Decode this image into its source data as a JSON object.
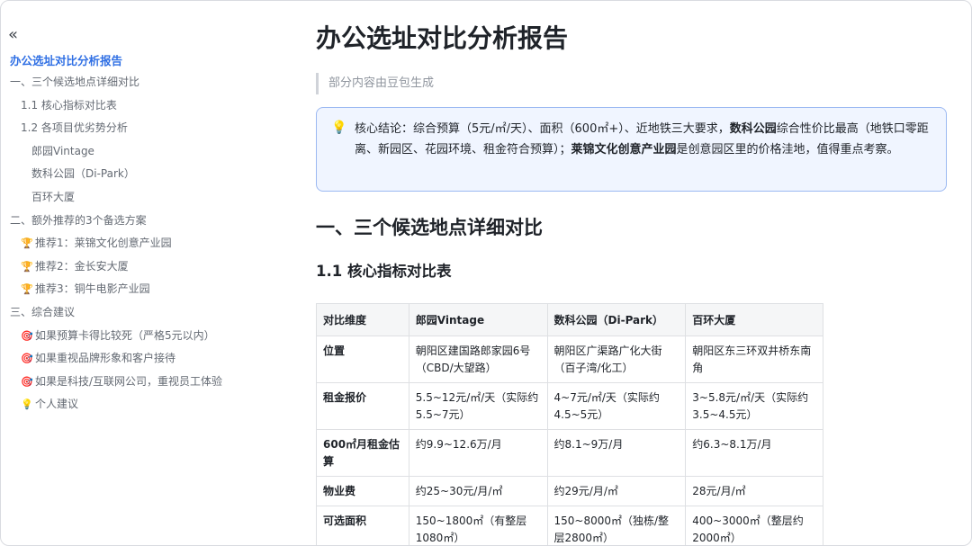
{
  "sidebar": {
    "collapse_icon": "«",
    "title": "办公选址对比分析报告",
    "items": [
      {
        "label": "一、三个候选地点详细对比",
        "emoji": ""
      },
      {
        "label": "1.1 核心指标对比表",
        "emoji": ""
      },
      {
        "label": "1.2 各项目优劣势分析",
        "emoji": ""
      },
      {
        "label": "郎园Vintage",
        "emoji": ""
      },
      {
        "label": "数科公园（Di-Park）",
        "emoji": ""
      },
      {
        "label": "百环大厦",
        "emoji": ""
      },
      {
        "label": "二、额外推荐的3个备选方案",
        "emoji": ""
      },
      {
        "label": "推荐1：莱锦文化创意产业园",
        "emoji": "🏆"
      },
      {
        "label": "推荐2：金长安大厦",
        "emoji": "🏆"
      },
      {
        "label": "推荐3：铜牛电影产业园",
        "emoji": "🏆"
      },
      {
        "label": "三、综合建议",
        "emoji": ""
      },
      {
        "label": "如果预算卡得比较死（严格5元以内）",
        "emoji": "🎯"
      },
      {
        "label": "如果重视品牌形象和客户接待",
        "emoji": "🎯"
      },
      {
        "label": "如果是科技/互联网公司，重视员工体验",
        "emoji": "🎯"
      },
      {
        "label": "个人建议",
        "emoji": "💡"
      }
    ]
  },
  "main": {
    "title": "办公选址对比分析报告",
    "quote": "部分内容由豆包生成",
    "callout": {
      "icon": "💡",
      "part1": "核心结论：综合预算（5元/㎡/天）、面积（600㎡+）、近地铁三大要求，",
      "bold1": "数科公园",
      "part2": "综合性价比最高（地铁口零距离、新园区、花园环境、租金符合预算）；",
      "bold2": "莱锦文化创意产业园",
      "part3": "是创意园区里的价格洼地，值得重点考察。"
    },
    "h1": "一、三个候选地点详细对比",
    "h2": "1.1 核心指标对比表",
    "table": {
      "headers": [
        "对比维度",
        "郎园Vintage",
        "数科公园（Di-Park）",
        "百环大厦"
      ],
      "rows": [
        [
          "位置",
          "朝阳区建国路郎家园6号（CBD/大望路）",
          "朝阳区广渠路广化大街（百子湾/化工）",
          "朝阳区东三环双井桥东南角"
        ],
        [
          "租金报价",
          "5.5~12元/㎡/天（实际约5.5~7元）",
          "4~7元/㎡/天（实际约4.5~5元）",
          "3~5.8元/㎡/天（实际约3.5~4.5元）"
        ],
        [
          "600㎡月租金估算",
          "约9.9~12.6万/月",
          "约8.1~9万/月",
          "约6.3~8.1万/月"
        ],
        [
          "物业费",
          "约25~30元/月/㎡",
          "约29元/月/㎡",
          "28元/月/㎡"
        ],
        [
          "可选面积",
          "150~1800㎡（有整层1080㎡）",
          "150~8000㎡（独栋/整层2800㎡）",
          "400~3000㎡（整层约2000㎡）"
        ]
      ]
    }
  }
}
